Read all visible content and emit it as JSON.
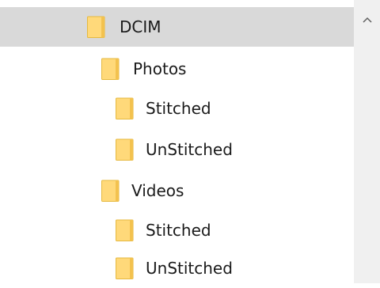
{
  "folder_tree": {
    "items": [
      {
        "label": "DCIM",
        "level": 0,
        "selected": true
      },
      {
        "label": "Photos",
        "level": 1,
        "selected": false
      },
      {
        "label": "Stitched",
        "level": 2,
        "selected": false
      },
      {
        "label": "UnStitched",
        "level": 2,
        "selected": false
      },
      {
        "label": "Videos",
        "level": 1,
        "selected": false
      },
      {
        "label": "Stitched",
        "level": 2,
        "selected": false
      },
      {
        "label": "UnStitched",
        "level": 2,
        "selected": false
      }
    ]
  },
  "scrollbar": {
    "up_icon": "chevron-up-icon"
  },
  "colors": {
    "folder_fill": "#ffd97a",
    "folder_edge": "#e6b93f",
    "selection": "#d9d9d9",
    "scrollbar_track": "#f0f0f0"
  }
}
